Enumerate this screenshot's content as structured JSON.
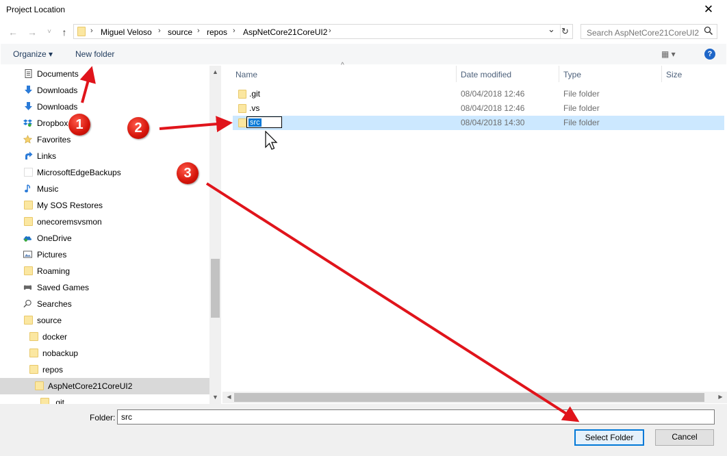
{
  "window": {
    "title": "Project Location",
    "close_glyph": "✕"
  },
  "address": {
    "crumbs": [
      "Miguel Veloso",
      "source",
      "repos",
      "AspNetCore21CoreUI2"
    ],
    "separator": "›",
    "dropdown_glyph": "⌄",
    "refresh_glyph": "↻"
  },
  "nav": {
    "back_glyph": "←",
    "forward_glyph": "→",
    "recent_glyph": "˅",
    "up_glyph": "↑"
  },
  "search": {
    "placeholder": "Search AspNetCore21CoreUI2"
  },
  "toolbar": {
    "organize_label": "Organize ▾",
    "new_folder_label": "New folder",
    "view_glyph": "▦ ▾",
    "help_glyph": "?"
  },
  "tree": [
    {
      "label": "Documents",
      "icon": "documents-icon"
    },
    {
      "label": "Downloads",
      "icon": "download-arrow-icon"
    },
    {
      "label": "Downloads",
      "icon": "download-arrow-icon"
    },
    {
      "label": "Dropbox",
      "icon": "dropbox-icon"
    },
    {
      "label": "Favorites",
      "icon": "star-icon"
    },
    {
      "label": "Links",
      "icon": "link-arrow-icon"
    },
    {
      "label": "MicrosoftEdgeBackups",
      "icon": "blank-folder-icon"
    },
    {
      "label": "Music",
      "icon": "music-note-icon"
    },
    {
      "label": "My SOS Restores",
      "icon": "folder-icon"
    },
    {
      "label": "onecoremsvsmon",
      "icon": "folder-icon"
    },
    {
      "label": "OneDrive",
      "icon": "onedrive-icon"
    },
    {
      "label": "Pictures",
      "icon": "pictures-icon"
    },
    {
      "label": "Roaming",
      "icon": "folder-icon"
    },
    {
      "label": "Saved Games",
      "icon": "saved-games-icon"
    },
    {
      "label": "Searches",
      "icon": "search-icon"
    },
    {
      "label": "source",
      "icon": "folder-icon"
    },
    {
      "label": "docker",
      "icon": "folder-icon"
    },
    {
      "label": "nobackup",
      "icon": "folder-icon"
    },
    {
      "label": "repos",
      "icon": "folder-icon"
    },
    {
      "label": "AspNetCore21CoreUI2",
      "icon": "folder-icon"
    },
    {
      "label": ".git",
      "icon": "folder-icon"
    }
  ],
  "columns": {
    "name": "Name",
    "date": "Date modified",
    "type": "Type",
    "size": "Size",
    "sort_glyph": "^"
  },
  "files": [
    {
      "name": ".git",
      "date": "08/04/2018 12:46",
      "type": "File folder"
    },
    {
      "name": ".vs",
      "date": "08/04/2018 12:46",
      "type": "File folder"
    },
    {
      "name": "src",
      "date": "08/04/2018 14:30",
      "type": "File folder"
    }
  ],
  "scroll": {
    "up": "▲",
    "down": "▼",
    "left": "◀",
    "right": "▶"
  },
  "footer": {
    "folder_label": "Folder:",
    "folder_value": "src",
    "select_label": "Select Folder",
    "cancel_label": "Cancel"
  },
  "annotations": {
    "badge1": "1",
    "badge2": "2",
    "badge3": "3",
    "color": "#e0141b"
  }
}
